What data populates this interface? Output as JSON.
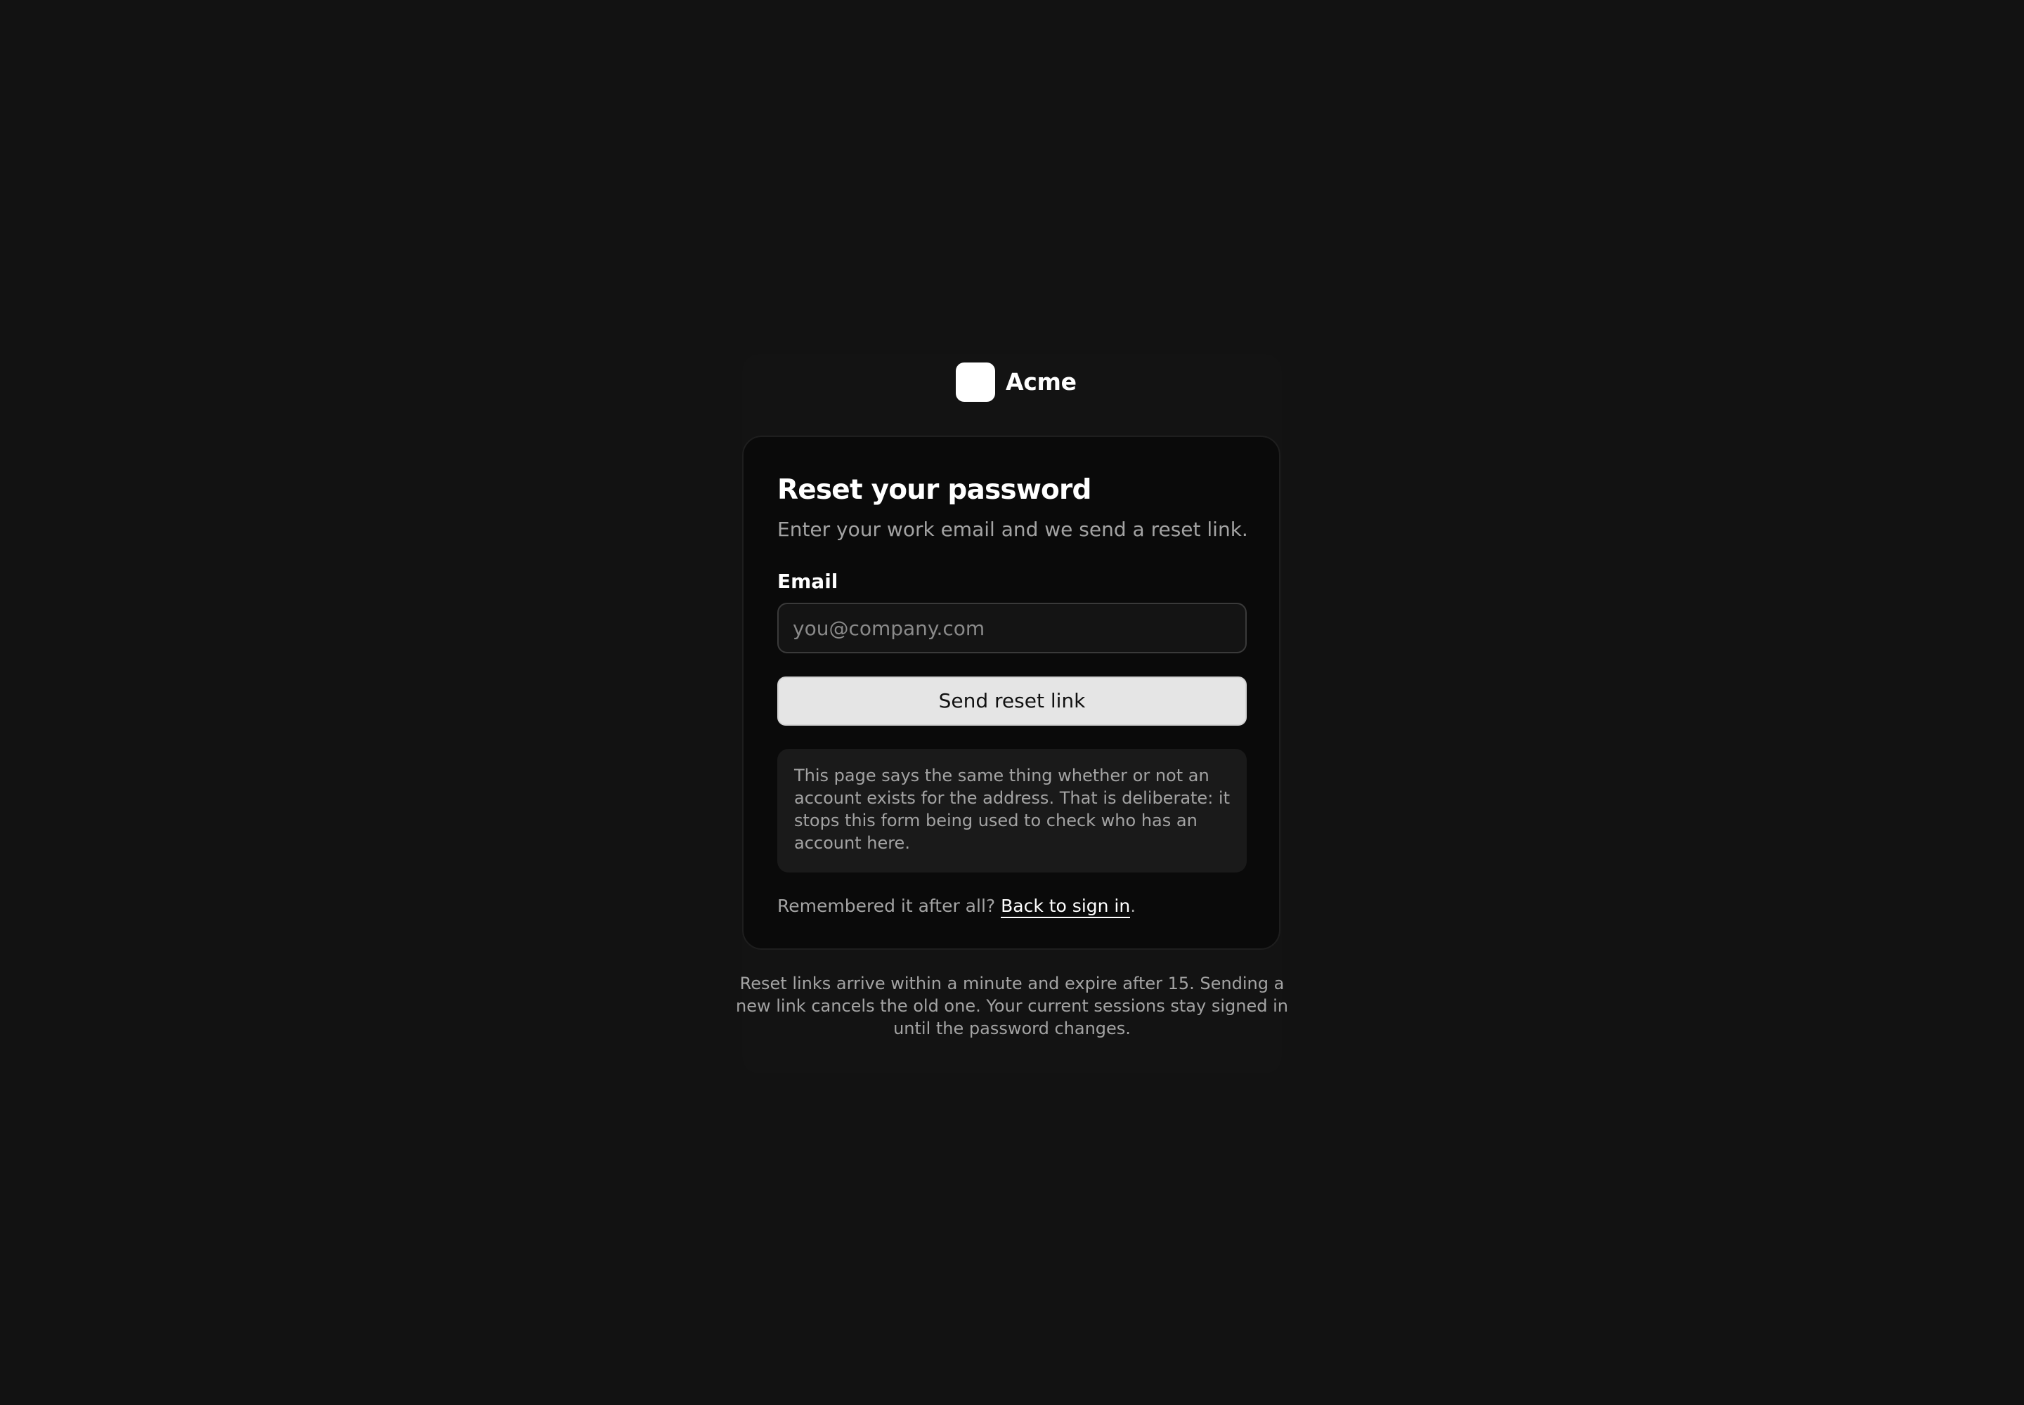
{
  "brand": {
    "name": "Acme",
    "logo_icon": "acme-logo-icon"
  },
  "card": {
    "title": "Reset your password",
    "subtitle": "Enter your work email and we send a reset link.",
    "email_label": "Email",
    "email_placeholder": "you@company.com",
    "email_value": "",
    "submit_label": "Send reset link",
    "notice": "This page says the same thing whether or not an account exists for the address. That is deliberate: it stops this form being used to check who has an account here.",
    "back_prompt": "Remembered it after all? ",
    "back_link": "Back to sign in",
    "back_suffix": "."
  },
  "footer": {
    "note": "Reset links arrive within a minute and expire after 15. Sending a new link cancels the old one. Your current sessions stay signed in until the password changes."
  },
  "colors": {
    "background": "#121212",
    "card": "#0a0a0a",
    "button": "#e5e5e5",
    "muted_text": "#a3a3a3"
  }
}
